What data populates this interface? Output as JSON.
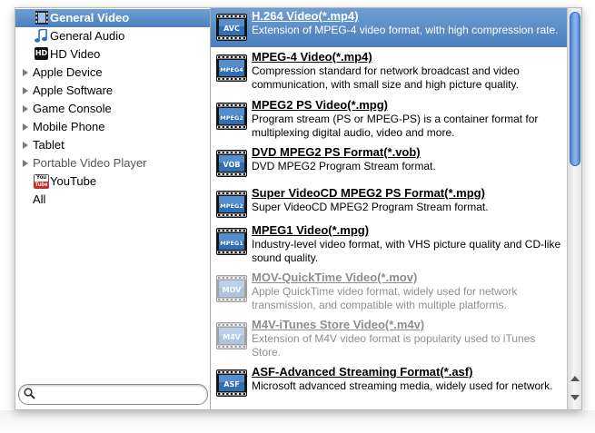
{
  "categories": [
    {
      "label": "General Video",
      "icon": "film-icon",
      "selected": true
    },
    {
      "label": "General Audio",
      "icon": "music-note-icon",
      "selected": false
    },
    {
      "label": "HD Video",
      "icon": "hd-icon",
      "selected": false
    },
    {
      "label": "Apple Device",
      "icon": "disclosure-triangle-icon",
      "selected": false
    },
    {
      "label": "Apple Software",
      "icon": "disclosure-triangle-icon",
      "selected": false
    },
    {
      "label": "Game Console",
      "icon": "disclosure-triangle-icon",
      "selected": false
    },
    {
      "label": "Mobile Phone",
      "icon": "disclosure-triangle-icon",
      "selected": false
    },
    {
      "label": "Tablet",
      "icon": "disclosure-triangle-icon",
      "selected": false
    },
    {
      "label": "Portable Video Player",
      "icon": "disclosure-triangle-icon",
      "selected": false
    },
    {
      "label": "YouTube",
      "icon": "youtube-icon",
      "selected": false
    },
    {
      "label": "All",
      "icon": "",
      "selected": false
    }
  ],
  "category_icon_text": {
    "hd": "HD",
    "youtube_top": "You",
    "youtube_bottom": "Tube"
  },
  "search": {
    "value": "",
    "placeholder": ""
  },
  "formats": [
    {
      "badge": "AVC",
      "name": "H.264 Video(*.mp4)",
      "description": "Extension of MPEG-4 video format, with high compression rate.",
      "selected": true,
      "faded": false
    },
    {
      "badge": "MPEG4",
      "name": "MPEG-4 Video(*.mp4)",
      "description": "Compression standard for network broadcast and video communication, with small size and high picture quality.",
      "selected": false,
      "faded": false
    },
    {
      "badge": "MPEG2",
      "name": "MPEG2 PS Video(*.mpg)",
      "description": "Program stream (PS or MPEG-PS) is a container format for multiplexing digital audio, video and more.",
      "selected": false,
      "faded": false
    },
    {
      "badge": "VOB",
      "name": "DVD MPEG2 PS Format(*.vob)",
      "description": "DVD MPEG2 Program Stream format.",
      "selected": false,
      "faded": false
    },
    {
      "badge": "MPEG2",
      "name": "Super VideoCD MPEG2 PS Format(*.mpg)",
      "description": "Super VideoCD MPEG2 Program Stream format.",
      "selected": false,
      "faded": false
    },
    {
      "badge": "MPEG1",
      "name": "MPEG1 Video(*.mpg)",
      "description": "Industry-level video format, with VHS picture quality and CD-like sound quality.",
      "selected": false,
      "faded": false
    },
    {
      "badge": "MOV",
      "name": "MOV-QuickTime Video(*.mov)",
      "description": "Apple QuickTime video format, widely used for network transmission, and compatible with multiple platforms.",
      "selected": false,
      "faded": true
    },
    {
      "badge": "M4V",
      "name": "M4V-iTunes Store Video(*.m4v)",
      "description": "Extension of M4V video format is popularity used to iTunes Store.",
      "selected": false,
      "faded": true
    },
    {
      "badge": "ASF",
      "name": "ASF-Advanced Streaming Format(*.asf)",
      "description": "Microsoft advanced streaming media, widely used for network.",
      "selected": false,
      "faded": false
    }
  ],
  "scrollbar": {
    "position": 0
  },
  "colors": {
    "selection": "#4f83c1",
    "badge": "#2f6fb4",
    "border": "#a9a9a9"
  }
}
